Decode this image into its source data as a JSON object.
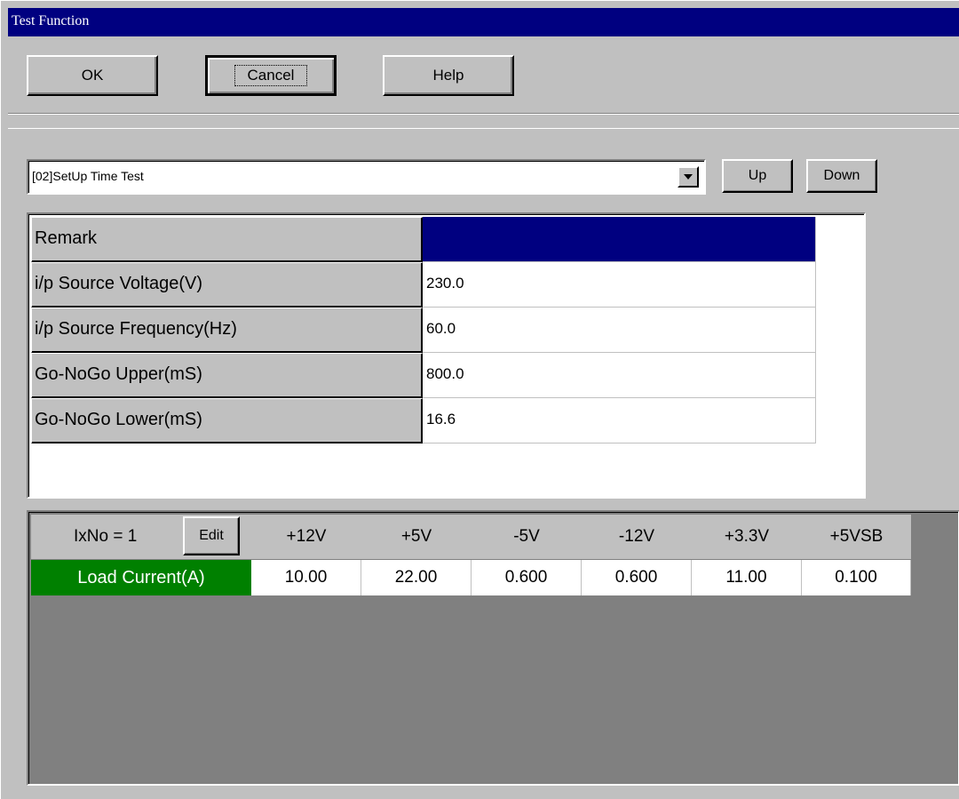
{
  "window": {
    "title": "Test Function"
  },
  "toolbar": {
    "ok_label": "OK",
    "cancel_label": "Cancel",
    "help_label": "Help"
  },
  "test_select": {
    "value": "[02]SetUp Time Test",
    "arrow_icon": "dropdown-arrow-icon"
  },
  "nav": {
    "up_label": "Up",
    "down_label": "Down"
  },
  "properties": [
    {
      "label": "Remark",
      "value": ""
    },
    {
      "label": "i/p Source Voltage(V)",
      "value": "230.0"
    },
    {
      "label": "i/p Source Frequency(Hz)",
      "value": "60.0"
    },
    {
      "label": "Go-NoGo Upper(mS)",
      "value": "800.0"
    },
    {
      "label": "Go-NoGo Lower(mS)",
      "value": "16.6"
    }
  ],
  "load_table": {
    "index_label": "IxNo = 1",
    "edit_label": "Edit",
    "columns": [
      "+12V",
      "+5V",
      "-5V",
      "-12V",
      "+3.3V",
      "+5VSB"
    ],
    "row_label": "Load Current(A)",
    "values": [
      "10.00",
      "22.00",
      "0.600",
      "0.600",
      "11.00",
      "0.100"
    ]
  },
  "colors": {
    "title_bar": "#000080",
    "face": "#c0c0c0",
    "selected_cell": "#000080",
    "row_label_bg": "#008000",
    "grid_bg": "#808080"
  }
}
